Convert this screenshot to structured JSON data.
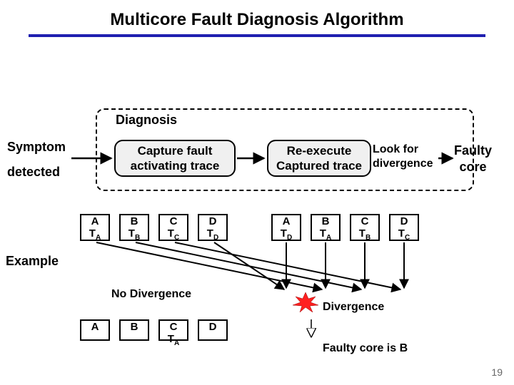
{
  "title": "Multicore Fault Diagnosis Algorithm",
  "diagnosis_label": "Diagnosis",
  "symptom_l1": "Symptom",
  "symptom_l2": "detected",
  "capture_l1": "Capture fault",
  "capture_l2": "activating trace",
  "reexec_l1": "Re-execute",
  "reexec_l2": "Captured trace",
  "lookfor_l1": "Look for",
  "lookfor_l2": "divergence",
  "faulty_l1": "Faulty",
  "faulty_l2": "core",
  "example": "Example",
  "no_divergence": "No Divergence",
  "divergence": "Divergence",
  "faulty_is": "Faulty core is B",
  "slide_num": "19",
  "cores_top_left": [
    {
      "head": "A",
      "tl": "T",
      "ts": "A"
    },
    {
      "head": "B",
      "tl": "T",
      "ts": "B"
    },
    {
      "head": "C",
      "tl": "T",
      "ts": "C"
    },
    {
      "head": "D",
      "tl": "T",
      "ts": "D"
    }
  ],
  "cores_top_right": [
    {
      "head": "A",
      "tl": "T",
      "ts": "D"
    },
    {
      "head": "B",
      "tl": "T",
      "ts": "A"
    },
    {
      "head": "C",
      "tl": "T",
      "ts": "B"
    },
    {
      "head": "D",
      "tl": "T",
      "ts": "C"
    }
  ],
  "cores_bottom": [
    {
      "head": "A"
    },
    {
      "head": "B"
    },
    {
      "head": "C",
      "tl": "T",
      "ts": "A"
    },
    {
      "head": "D"
    }
  ]
}
